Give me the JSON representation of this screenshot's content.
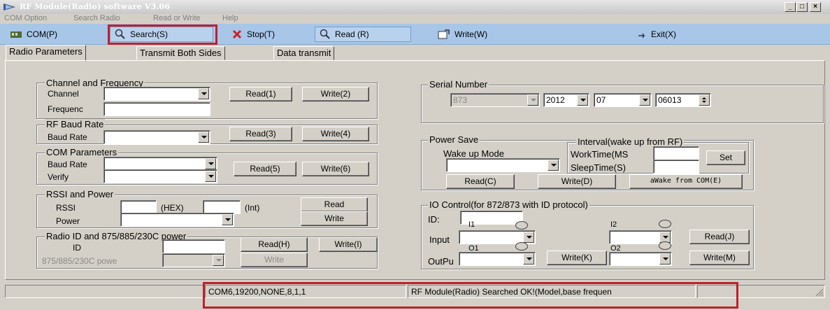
{
  "window": {
    "title": "RF Module(Radio) software  V3.06",
    "minimize": "_",
    "maximize": "□",
    "close": "×"
  },
  "menu": [
    "COM Option",
    "Search Radio",
    "Read or Write",
    "Help"
  ],
  "toolbar": {
    "com": "COM(P)",
    "search": "Search(S)",
    "stop": "Stop(T)",
    "read": "Read (R)",
    "write": "Write(W)",
    "exit": "Exit(X)"
  },
  "tabs": [
    "Radio Parameters",
    "Transmit Both Sides",
    "Data transmit"
  ],
  "channel_freq": {
    "title": "Channel and Frequency",
    "channel_label": "Channel",
    "frequency_label": "Frequenc",
    "channel_value": "",
    "frequency_value": "",
    "read": "Read(1)",
    "write": "Write(2)"
  },
  "rf_baud": {
    "title": "RF Baud Rate",
    "baud_label": "Baud Rate",
    "baud_value": "",
    "read": "Read(3)",
    "write": "Write(4)"
  },
  "com_params": {
    "title": "COM Parameters",
    "baud_label": "Baud Rate",
    "verify_label": "Verify",
    "read": "Read(5)",
    "write": "Write(6)"
  },
  "rssi": {
    "title": "RSSI and Power",
    "rssi_label": "RSSI",
    "hex": "(HEX)",
    "int": "(Int)",
    "power_label": "Power",
    "read": "Read",
    "write": "Write"
  },
  "radio_id": {
    "title": "Radio ID and 875/885/230C power",
    "id_label": "ID",
    "power_label": "875/885/230C powe",
    "read": "Read(H)",
    "write_id": "Write(I)",
    "write": "Write"
  },
  "serial": {
    "title": "Serial Number",
    "model": "873",
    "year": "2012",
    "month": "07",
    "number": "06013"
  },
  "power_save": {
    "title": "Power Save",
    "wake_mode_label": "Wake up Mode",
    "interval_title": "Interval(wake up from RF)",
    "worktime_label": "WorkTime(MS",
    "sleeptime_label": "SleepTime(S)",
    "set": "Set",
    "read": "Read(C)",
    "write": "Write(D)",
    "wake_com": "aWake from COM(E)"
  },
  "io_control": {
    "title": "IO Control(for 872/873 with ID protocol)",
    "id_label": "ID:",
    "i1": "I1",
    "i2": "I2",
    "o1": "O1",
    "o2": "O2",
    "input_label": "Input",
    "output_label": "OutPu",
    "read": "Read(J)",
    "write_k": "Write(K)",
    "write_m": "Write(M)"
  },
  "status": {
    "left": "",
    "com": "COM6,19200,NONE,8,1,1",
    "message": "RF Module(Radio) Searched OK!(Model,base frequen"
  }
}
